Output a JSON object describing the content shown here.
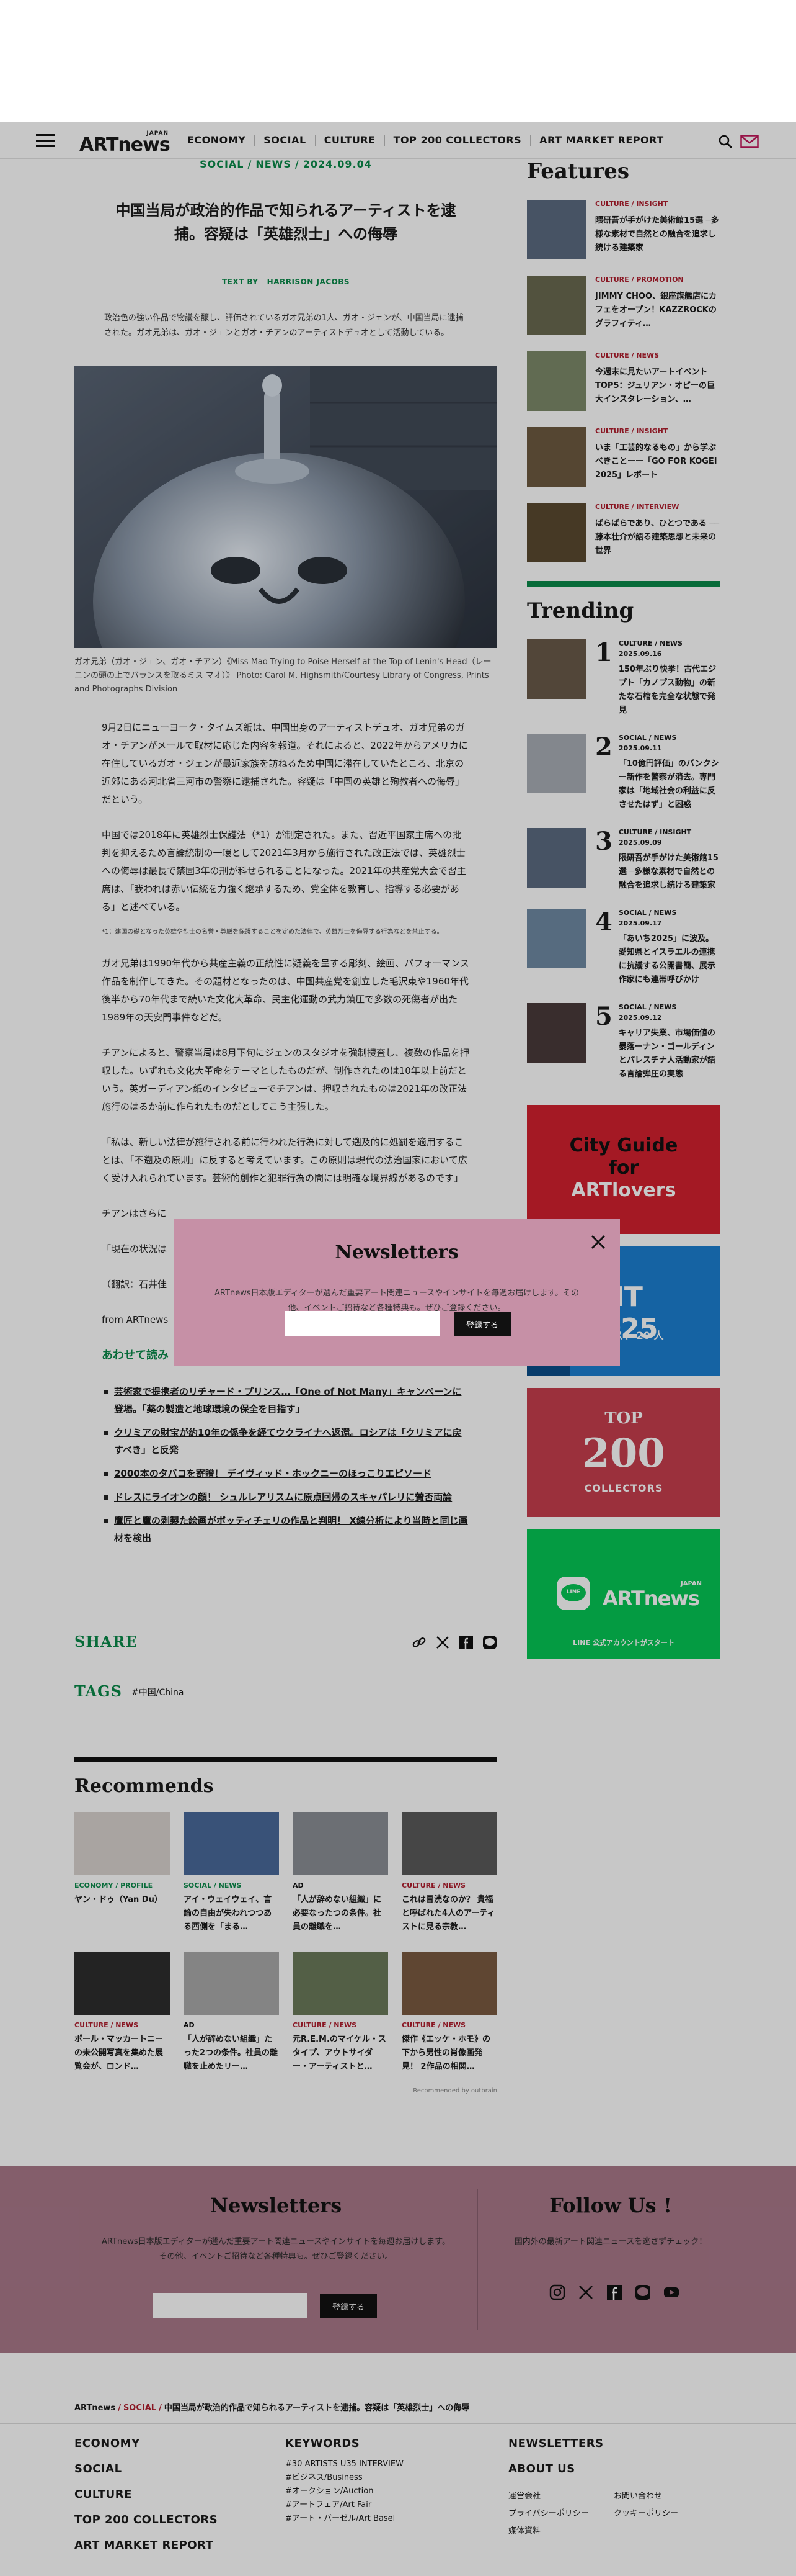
{
  "header": {
    "logo_japan": "JAPAN",
    "logo_main": "ARTnews",
    "nav": [
      "ECONOMY",
      "SOCIAL",
      "CULTURE",
      "TOP 200 COLLECTORS",
      "ART MARKET REPORT"
    ]
  },
  "article": {
    "crumb_cat1": "SOCIAL",
    "crumb_cat2": "NEWS",
    "crumb_date": "2024.09.04",
    "title": "中国当局が政治的作品で知られるアーティストを逮捕。容疑は「英雄烈士」への侮辱",
    "byline_prefix": "TEXT BY",
    "byline_author": "HARRISON JACOBS",
    "lede": "政治色の強い作品で物議を醸し、評価されているガオ兄弟の1人、ガオ・ジェンが、中国当局に逮捕された。ガオ兄弟は、ガオ・ジェンとガオ・チアンのアーティストデュオとして活動している。",
    "caption": "ガオ兄弟（ガオ・ジェン、ガオ・チアン）《Miss Mao Trying to Poise Herself at the Top of Lenin's Head（レーニンの頭の上でバランスを取るミス マオ）》 Photo: Carol M. Highsmith/Courtesy Library of Congress, Prints and Photographs Division",
    "paragraphs": [
      "9月2日にニューヨーク・タイムズ紙は、中国出身のアーティストデュオ、ガオ兄弟のガオ・チアンがメールで取材に応じた内容を報道。それによると、2022年からアメリカに在住しているガオ・ジェンが最近家族を訪ねるため中国に滞在していたところ、北京の近郊にある河北省三河市の警察に逮捕された。容疑は「中国の英雄と殉教者への侮辱」だという。",
      "中国では2018年に英雄烈士保護法（*1）が制定された。また、習近平国家主席への批判を抑えるため言論統制の一環として2021年3月から施行された改正法では、英雄烈士への侮辱は最長で禁固3年の刑が科せられることになった。2021年の共産党大会で習主席は、「我われは赤い伝統を力強く継承するため、党全体を教育し、指導する必要がある」と述べている。",
      "ガオ兄弟は1990年代から共産主義の正統性に疑義を呈する彫刻、絵画、パフォーマンス作品を制作してきた。その題材となったのは、中国共産党を創立した毛沢東や1960年代後半から70年代まで続いた文化大革命、民主化運動の武力鎮圧で多数の死傷者が出た1989年の天安門事件などだ。",
      "チアンによると、警察当局は8月下旬にジェンのスタジオを強制捜査し、複数の作品を押収した。いずれも文化大革命をテーマとしたものだが、制作されたのは10年以上前だという。英ガーディアン紙のインタビューでチアンは、押収されたものは2021年の改正法施行のはるか前に作られたものだとしてこう主張した。",
      "「私は、新しい法律が施行される前に行われた行為に対して遡及的に処罰を適用することは、「不遡及の原則」に反すると考えています。この原則は現代の法治国家において広く受け入れられています。芸術的創作と犯罪行為の間には明確な境界線があるのです」",
      "チアンはさらに",
      "「現在の状況は",
      "（翻訳：石井佳"
    ],
    "footnote": "*1：建国の礎となった英雄や烈士の名誉・尊厳を保護することを定めた法律で、英雄烈士を侮辱する行為などを禁止する。",
    "from_text": "from ARTnews",
    "read_also": "あわせて読み",
    "related": [
      "芸術家で提携者のリチャード・プリンス…「One of Not Many」キャンペーンに登場。「薬の製造と地球環境の保全を目指す」",
      "クリミアの財宝が約10年の係争を経てウクライナへ返還。ロシアは「クリミアに戻すべき」と反発",
      "2000本のタバコを寄贈！ デイヴィッド・ホックニーのほっこりエピソード",
      "ドレスにライオンの顔！ シュルレアリスムに原点回帰のスキャパレリに賛否両論",
      "鷹匠と鷹の剥製た絵画がボッティチェリの作品と判明！ X線分析により当時と同じ画材を検出"
    ]
  },
  "share": {
    "label": "SHARE"
  },
  "tags": {
    "label": "TAGS",
    "tag": "#中国/China"
  },
  "recommends": {
    "title": "Recommends",
    "items": [
      {
        "cat": "ECONOMY / PROFILE",
        "title": "ヤン・ドゥ（Yan Du）"
      },
      {
        "cat": "SOCIAL / NEWS",
        "title": "アイ・ウェイウェイ、言論の自由が失われつつある西側を「まる…"
      },
      {
        "cat": "AD",
        "title": "「人が辞めない組織」に必要なったつの条件。社員の離職を…"
      },
      {
        "cat": "CULTURE / NEWS",
        "title": "これは冒涜なのか？ 貴福と呼ばれた4人のアーティストに見る宗教…"
      },
      {
        "cat": "CULTURE / NEWS",
        "title": "ポール・マッカートニーの未公開写真を集めた展覧会が、ロンド…"
      },
      {
        "cat": "AD",
        "title": "「人が辞めない組織」たった2つの条件。社員の離職を止めたリー…"
      },
      {
        "cat": "CULTURE / NEWS",
        "title": "元R.E.M.のマイケル・スタイプ、アウトサイダー・アーティストと…"
      },
      {
        "cat": "CULTURE / NEWS",
        "title": "傑作《エッケ・ホモ》の下から男性の肖像画発見！ 2作品の相関…"
      }
    ],
    "powered": "Recommended by outbrain"
  },
  "sidebar": {
    "features_title": "Features",
    "features": [
      {
        "cat": "CULTURE / INSIGHT",
        "title": "隈研吾が手がけた美術館15選 ─多様な素材で自然との融合を追求し続ける建築家"
      },
      {
        "cat": "CULTURE / PROMOTION",
        "title": "JIMMY CHOO、銀座旗艦店にカフェをオープン！KAZZROCKのグラフィティ…"
      },
      {
        "cat": "CULTURE / NEWS",
        "title": "今週末に見たいアートイベントTOP5：ジュリアン・オピーの巨大インスタレーション、…"
      },
      {
        "cat": "CULTURE / INSIGHT",
        "title": "いま「工芸的なるもの」から学ぶべきことーー「GO FOR KOGEI 2025」レポート"
      },
      {
        "cat": "CULTURE / INTERVIEW",
        "title": "ばらばらであり、ひとつである ──藤本壮介が語る建築思想と未来の世界"
      }
    ],
    "trending_title": "Trending",
    "trending": [
      {
        "num": "1",
        "cat": "CULTURE / NEWS",
        "date": "2025.09.16",
        "title": "150年ぶり快挙！古代エジプト「カノプス動物」の新たな石棺を完全な状態で発見"
      },
      {
        "num": "2",
        "cat": "SOCIAL / NEWS",
        "date": "2025.09.11",
        "title": "「10億円評価」のバンクシー新作を警察が消去。専門家は「地域社会の利益に反させたはず」と困惑"
      },
      {
        "num": "3",
        "cat": "CULTURE / INSIGHT",
        "date": "2025.09.09",
        "title": "隈研吾が手がけた美術館15選 ─多様な素材で自然との融合を追求し続ける建築家"
      },
      {
        "num": "4",
        "cat": "SOCIAL / NEWS",
        "date": "2025.09.17",
        "title": "「あいち2025」に波及。愛知県とイスラエルの連携に抗議する公開書簡、展示作家にも連帯呼びかけ"
      },
      {
        "num": "5",
        "cat": "SOCIAL / NEWS",
        "date": "2025.09.12",
        "title": "キャリア失業、市場価値の暴落ーナン・ゴールディンとパレスチナ人活動家が語る言論弾圧の実態"
      }
    ],
    "banner1_l1": "City Guide",
    "banner1_l2": "for",
    "banner1_l3": "ARTlovers",
    "banner2_big": "ENT 2025",
    "banner2_small": "ーティスト 20 人",
    "banner3_top": "TOP",
    "banner3_num": "200",
    "banner3_bottom": "COLLECTORS",
    "banner4_japan": "JAPAN",
    "banner4_brand": "ARTnews",
    "banner4_line": "LINE",
    "banner4_caption": "LINE 公式アカウントがスタート"
  },
  "modal": {
    "title": "Newsletters",
    "text": "ARTnews日本版エディターが選んだ重要アート関連ニュースやインサイトを毎週お届けします。その他、イベントご招待など各種特典も。ぜひご登録ください。",
    "button": "登録する"
  },
  "footer_news": {
    "title": "Newsletters",
    "text": "ARTnews日本版エディターが選んだ重要アート関連ニュースやインサイトを毎週お届けします。その他、イベントご招待など各種特典も。ぜひご登録ください。",
    "button": "登録する",
    "follow_title": "Follow Us !",
    "follow_text": "国内外の最新アート関連ニュースを逃さずチェック！"
  },
  "footer": {
    "crumb_home": "ARTnews",
    "crumb_cat": "SOCIAL",
    "crumb_title": "中国当局が政治的作品で知られるアーティストを逮捕。容疑は「英雄烈士」への侮辱",
    "nav": [
      "ECONOMY",
      "SOCIAL",
      "CULTURE",
      "TOP 200 COLLECTORS",
      "ART MARKET REPORT"
    ],
    "keywords_title": "KEYWORDS",
    "keywords": [
      "#30 ARTISTS U35 INTERVIEW",
      "#ビジネス/Business",
      "#オークション/Auction",
      "#アートフェア/Art Fair",
      "#アート・バーゼル/Art Basel"
    ],
    "newsletters": "NEWSLETTERS",
    "about": "ABOUT US",
    "links": [
      "運営会社",
      "お問い合わせ",
      "プライバシーポリシー",
      "クッキーポリシー",
      "媒体資料"
    ]
  },
  "colors": {
    "green": "#0a8a4a",
    "red": "#b01e2e",
    "modal_bg": "#c690a6",
    "footer_bg": "#a9798a"
  }
}
